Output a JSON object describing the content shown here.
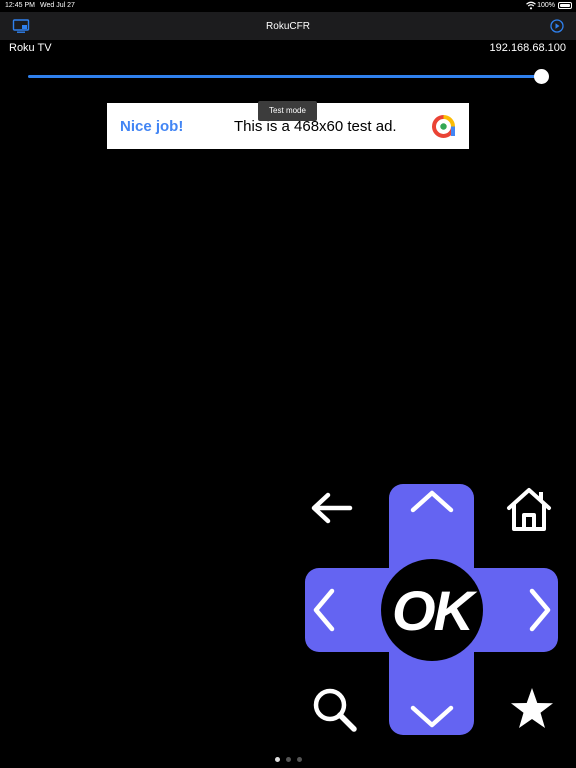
{
  "status_bar": {
    "time": "12:45 PM",
    "date": "Wed Jul 27",
    "battery": "100%"
  },
  "nav_bar": {
    "title": "RokuCFR",
    "left_icon": "cast-icon",
    "right_icon": "play-circle-icon"
  },
  "device": {
    "name": "Roku TV",
    "ip": "192.168.68.100"
  },
  "volume_slider": {
    "value_fraction": 1.0
  },
  "ad": {
    "headline": "Nice job!",
    "body": "This is a 468x60 test ad.",
    "badge": "Test mode"
  },
  "remote": {
    "ok_label": "OK",
    "buttons": [
      "back-icon",
      "home-icon",
      "search-icon",
      "star-icon",
      "up-arrow-icon",
      "down-arrow-icon",
      "left-arrow-icon",
      "right-arrow-icon"
    ],
    "dpad_color": "#6464f2"
  },
  "pager": {
    "pages": 3,
    "active": 0
  }
}
